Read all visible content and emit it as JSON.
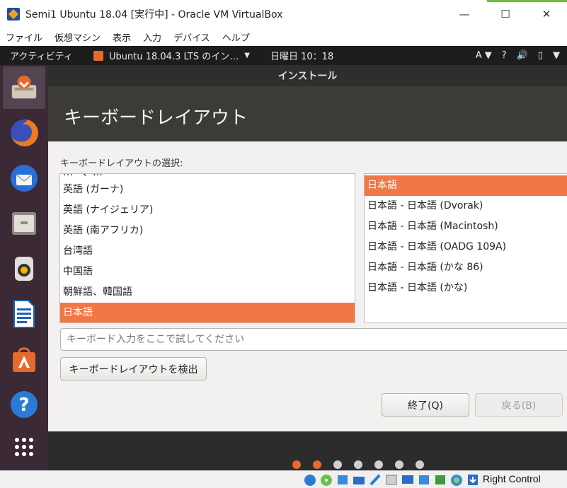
{
  "window": {
    "title": "Semi1 Ubuntu 18.04 [実行中] - Oracle VM VirtualBox",
    "minimize": "—",
    "maximize": "☐",
    "close": "✕"
  },
  "host_menu": [
    "ファイル",
    "仮想マシン",
    "表示",
    "入力",
    "デバイス",
    "ヘルプ"
  ],
  "ubuntu_topbar": {
    "activities": "アクティビティ",
    "app_name": "Ubuntu 18.04.3 LTS のイン…",
    "app_arrow": "▼",
    "clock": "日曜日 10：18",
    "input_method": "A ▼",
    "tray_accessibility": "?",
    "tray_sound": "🔊",
    "tray_battery": "▯",
    "tray_menu": "▼"
  },
  "dock": {
    "items": [
      {
        "name": "installer",
        "color": "#c9c1b4",
        "accent": "#e66a2c",
        "active": true
      },
      {
        "name": "firefox",
        "color": "#e86a1f",
        "accent": "#3a6fd8"
      },
      {
        "name": "thunderbird",
        "color": "#2a6fd6",
        "accent": "#ffffff"
      },
      {
        "name": "files",
        "color": "#8d8a85",
        "accent": "#d6d3ce"
      },
      {
        "name": "rhythmbox",
        "color": "#d8d5cf",
        "accent": "#f2b500"
      },
      {
        "name": "libreoffice-writer",
        "color": "#1e63b8",
        "accent": "#ffffff"
      },
      {
        "name": "ubuntu-software",
        "color": "#e66a2c",
        "accent": "#ffffff"
      },
      {
        "name": "help",
        "color": "#2b7bd6",
        "accent": "#ffffff"
      },
      {
        "name": "show-applications",
        "color": "#3b2a35",
        "accent": "#ffffff"
      }
    ]
  },
  "installer": {
    "window_title": "インストール",
    "heading": "キーボードレイアウト",
    "section_label": "キーボードレイアウトの選択:",
    "layouts": [
      "英語 (ガーナ)",
      "英語 (ナイジェリア)",
      "英語 (南アフリカ)",
      "台湾語",
      "中国語",
      "朝鮮語、韓国語",
      "日本語"
    ],
    "layouts_partial_top": "…ー、…",
    "selected_layout": "日本語",
    "variants": [
      "日本語",
      "日本語 - 日本語 (Dvorak)",
      "日本語 - 日本語 (Macintosh)",
      "日本語 - 日本語 (OADG 109A)",
      "日本語 - 日本語 (かな 86)",
      "日本語 - 日本語 (かな)"
    ],
    "selected_variant": "日本語",
    "test_placeholder": "キーボード入力をここで試してください",
    "detect_button": "キーボードレイアウトを検出",
    "quit_button": "終了(Q)",
    "back_button": "戻る(B)",
    "progress": {
      "total_steps": 7,
      "completed_steps": 2
    },
    "accent_color": "#f07746"
  },
  "host_status": {
    "host_key": "Right Control"
  }
}
